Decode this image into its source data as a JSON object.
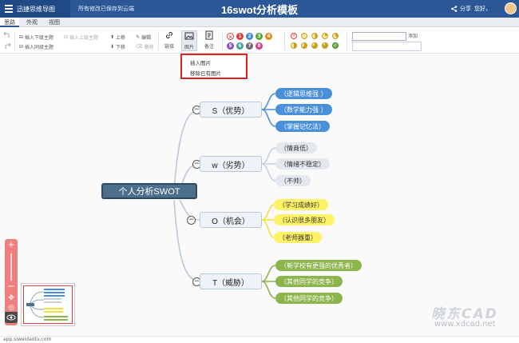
{
  "app": {
    "name": "迅捷思维导图",
    "save_status": "所有修改已保存到云端",
    "doc_title": "16swot分析模板",
    "share_label": "分享",
    "user_greeting": "您好，"
  },
  "tabs": [
    {
      "label": "思路",
      "active": true
    },
    {
      "label": "外观",
      "active": false
    },
    {
      "label": "视图",
      "active": false
    }
  ],
  "toolbar": {
    "insert_child": "插入下级主题",
    "insert_parent": "插入上级主题",
    "insert_sibling": "插入同级主题",
    "move_up": "上移",
    "move_down": "下移",
    "edit": "编辑",
    "delete": "删除",
    "link": "链接",
    "image": "图片",
    "note": "备注",
    "priorities": [
      "1",
      "2",
      "3",
      "4",
      "5",
      "6",
      "7",
      "8"
    ],
    "priority_colors": [
      "#e23b3b",
      "#3a8ad6",
      "#5aa83a",
      "#e88a1f",
      "#8a4fbf",
      "#3fa0a0",
      "#6a6a6a",
      "#d63a8a"
    ],
    "search_add": "添加"
  },
  "image_menu": {
    "items": [
      "插入图片",
      "移除已有图片"
    ]
  },
  "mindmap": {
    "root": "个人分析SWOT",
    "branches": [
      {
        "label": "S（优势）",
        "color": "blue",
        "children": [
          "（逻辑思维强 ）",
          "（数学能力强 ）",
          "（掌握记忆法）"
        ]
      },
      {
        "label": "w（劣势）",
        "color": "gray",
        "children": [
          "（情商低）",
          "（情绪不稳定）",
          "（不帅）"
        ]
      },
      {
        "label": "O（机会）",
        "color": "yellow",
        "children": [
          "（学习成绩好）",
          "（认识很多朋友）",
          "（老师器重）"
        ]
      },
      {
        "label": "T（威胁）",
        "color": "green",
        "children": [
          "（新学校有更强的优秀者）",
          "（其他同学的竞争）",
          "（其他同学的竞争）"
        ]
      }
    ],
    "toggle_symbol": "−"
  },
  "zoom": {
    "in": "+",
    "out": "−"
  },
  "status_url": "app.siweidaotu.com",
  "watermark": {
    "brand": "晓东CAD",
    "url": "www.xdcad.net"
  }
}
